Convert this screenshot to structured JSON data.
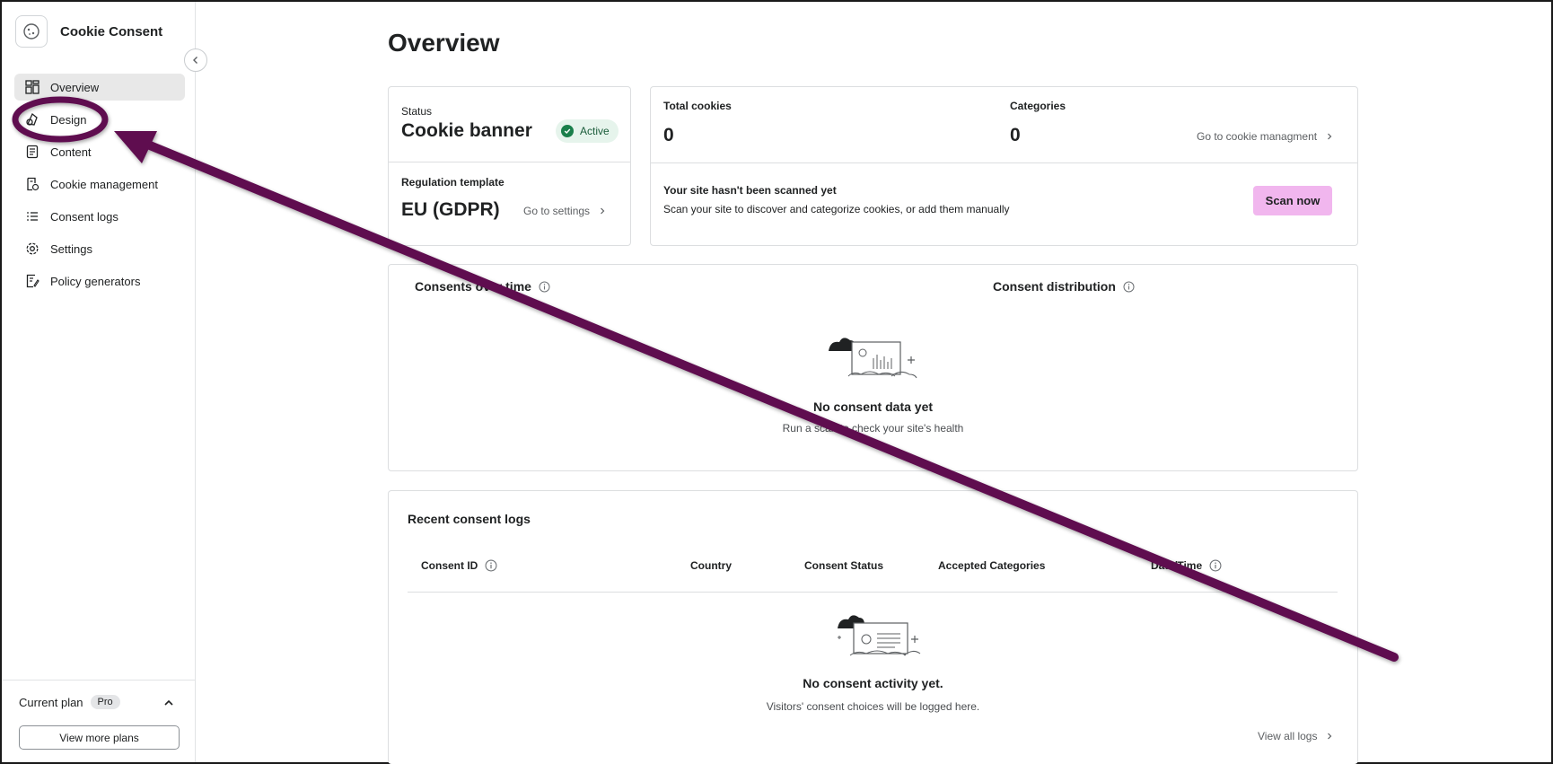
{
  "app": {
    "title": "Cookie Consent"
  },
  "sidebar": {
    "items": [
      {
        "label": "Overview",
        "icon": "dashboard-grid-icon"
      },
      {
        "label": "Design",
        "icon": "palette-icon"
      },
      {
        "label": "Content",
        "icon": "document-icon"
      },
      {
        "label": "Cookie management",
        "icon": "cookie-doc-icon"
      },
      {
        "label": "Consent logs",
        "icon": "list-icon"
      },
      {
        "label": "Settings",
        "icon": "gear-icon"
      },
      {
        "label": "Policy generators",
        "icon": "policy-edit-icon"
      }
    ],
    "active": "Overview",
    "plan": {
      "label": "Current plan",
      "badge": "Pro",
      "button": "View more plans"
    }
  },
  "main": {
    "title": "Overview",
    "status_card": {
      "status_label": "Status",
      "status_value": "Cookie banner",
      "status_badge": "Active",
      "regulation_label": "Regulation template",
      "regulation_value": "EU (GDPR)",
      "settings_link": "Go to settings"
    },
    "totals_card": {
      "cookies_label": "Total cookies",
      "cookies_value": "0",
      "categories_label": "Categories",
      "categories_value": "0",
      "manage_link": "Go to cookie managment",
      "scan_title": "Your site hasn't been scanned yet",
      "scan_desc": "Scan your site to discover and categorize cookies, or add them manually",
      "scan_button": "Scan now"
    },
    "charts_card": {
      "left_title": "Consents over time",
      "right_title": "Consent distribution",
      "empty_title": "No consent data yet",
      "empty_sub": "Run a scan to check your site's health"
    },
    "logs_card": {
      "title": "Recent consent logs",
      "columns": [
        "Consent ID",
        "Country",
        "Consent Status",
        "Accepted Categories",
        "Date/Time"
      ],
      "empty_title": "No consent activity yet.",
      "empty_sub": "Visitors' consent choices will be logged here.",
      "view_all": "View all logs"
    }
  },
  "colors": {
    "annotation": "#5e0b4f",
    "scan_button": "#f1b6ee",
    "active_badge": "#1a7f4b"
  }
}
